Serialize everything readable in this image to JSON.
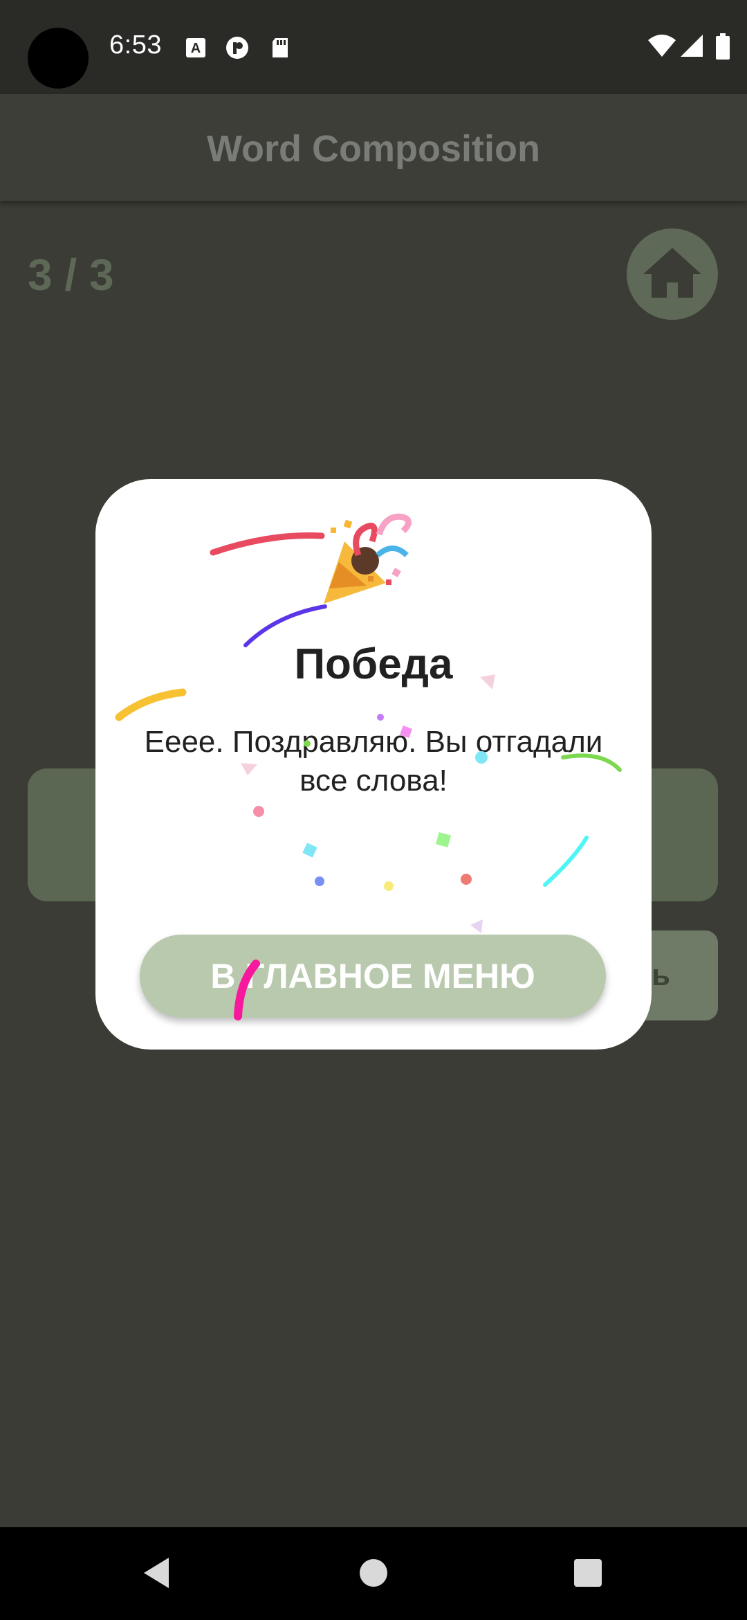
{
  "status_bar": {
    "time": "6:53",
    "icons": [
      "a-badge-icon",
      "p-badge-icon",
      "sd-card-icon",
      "wifi-icon",
      "signal-icon",
      "battery-icon"
    ]
  },
  "app_bar": {
    "title": "Word Composition"
  },
  "game": {
    "progress": "3 / 3",
    "side_button_label": "ь"
  },
  "dialog": {
    "emoji": "party-popper-icon",
    "title": "Победа",
    "message": "Eeee. Поздравляю. Вы отгадали все слова!",
    "button_label": "В ГЛАВНОЕ МЕНЮ"
  },
  "colors": {
    "accent": "#b9c9ae",
    "background": "#3a3c35",
    "dialog_bg": "#ffffff"
  },
  "nav_bar": {
    "icons": [
      "back-icon",
      "home-circle-icon",
      "recents-icon"
    ]
  }
}
